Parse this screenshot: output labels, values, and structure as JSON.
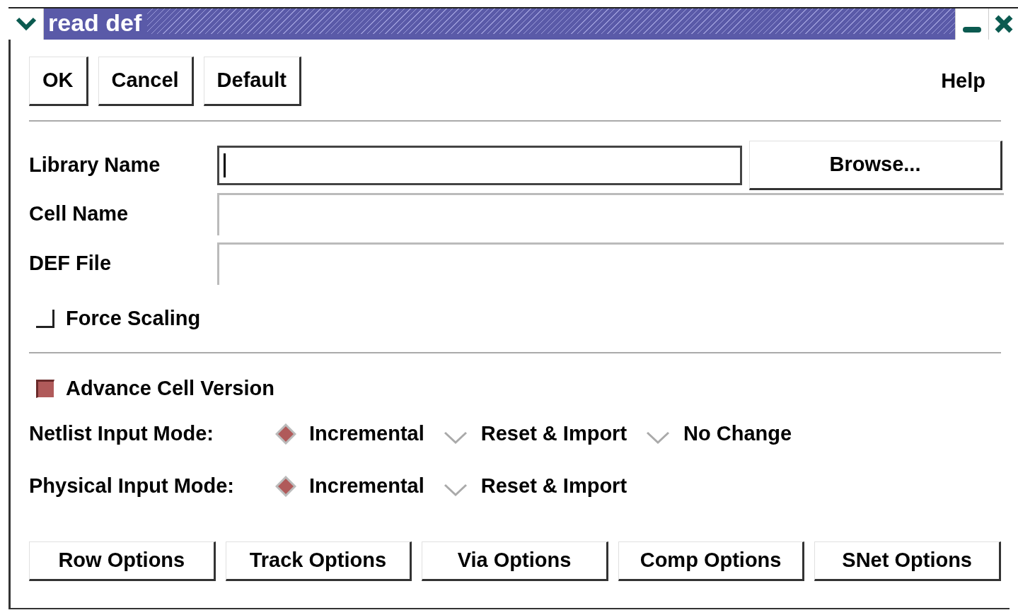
{
  "window": {
    "title": "read def"
  },
  "top_buttons": [
    "OK",
    "Cancel",
    "Default"
  ],
  "help": "Help",
  "fields": [
    {
      "label": "Library Name",
      "kind": "active",
      "focused": true,
      "button": "Browse..."
    },
    {
      "label": "Cell Name",
      "kind": "inactive"
    },
    {
      "label": "DEF File",
      "kind": "inactive"
    }
  ],
  "force_scaling": {
    "label": "Force Scaling",
    "checked": false
  },
  "advance_cell_version": {
    "label": "Advance Cell Version",
    "checked": true
  },
  "radio_groups": [
    {
      "label": "Netlist Input Mode:",
      "options": [
        {
          "label": "Incremental",
          "selected": true
        },
        {
          "label": "Reset & Import",
          "selected": false
        },
        {
          "label": "No Change",
          "selected": false
        }
      ]
    },
    {
      "label": "Physical Input Mode:",
      "options": [
        {
          "label": "Incremental",
          "selected": true
        },
        {
          "label": "Reset & Import",
          "selected": false
        }
      ]
    }
  ],
  "bottom_buttons": [
    "Row Options",
    "Track Options",
    "Via Options",
    "Comp Options",
    "SNet Options"
  ]
}
